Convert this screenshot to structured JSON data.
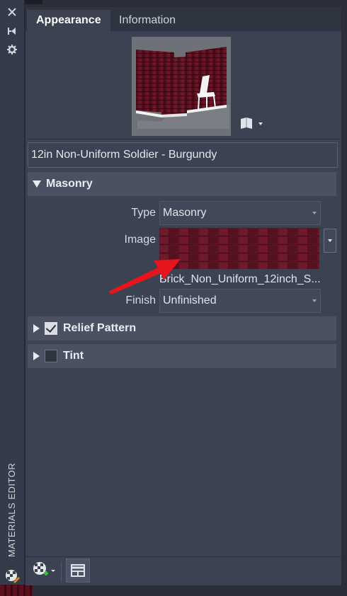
{
  "strip": {
    "title": "MATERIALS EDITOR",
    "icons": [
      "close-icon",
      "auto-hide-icon",
      "settings-icon"
    ]
  },
  "tabs": [
    {
      "label": "Appearance",
      "active": true
    },
    {
      "label": "Information",
      "active": false
    }
  ],
  "material": {
    "name": "12in Non-Uniform Soldier - Burgundy"
  },
  "sections": {
    "masonry": {
      "label": "Masonry",
      "expanded": true,
      "type_label": "Type",
      "type_value": "Masonry",
      "image_label": "Image",
      "image_caption": "Brick_Non_Uniform_12inch_S...",
      "finish_label": "Finish",
      "finish_value": "Unfinished"
    },
    "relief": {
      "label": "Relief Pattern",
      "checked": true
    },
    "tint": {
      "label": "Tint",
      "checked": false
    }
  },
  "colors": {
    "brick": "#5a1424",
    "arrow": "#e8141b",
    "panel": "#3b4251"
  }
}
